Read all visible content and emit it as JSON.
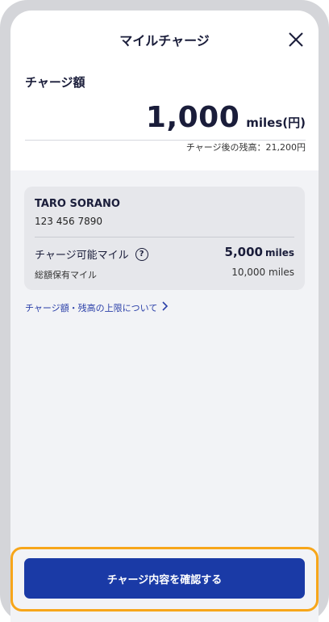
{
  "header": {
    "title": "マイルチャージ"
  },
  "charge": {
    "label": "チャージ額",
    "amount": "1,000",
    "unit": "miles(円)",
    "balance_after": "チャージ後の残高：21,200円"
  },
  "card": {
    "name": "TARO SORANO",
    "number": "123 456 7890",
    "chargeable_label": "チャージ可能マイル",
    "chargeable_value": "5,000",
    "chargeable_unit": "miles",
    "total_label": "総額保有マイル",
    "total_value": "10,000 miles"
  },
  "help_icon_glyph": "?",
  "limit_link": "チャージ額・残高の上限について",
  "confirm_button": "チャージ内容を確認する",
  "colors": {
    "primary": "#1a3aa6",
    "highlight": "#f7a61a",
    "text": "#1a1d3a",
    "link": "#2a3fa8"
  }
}
